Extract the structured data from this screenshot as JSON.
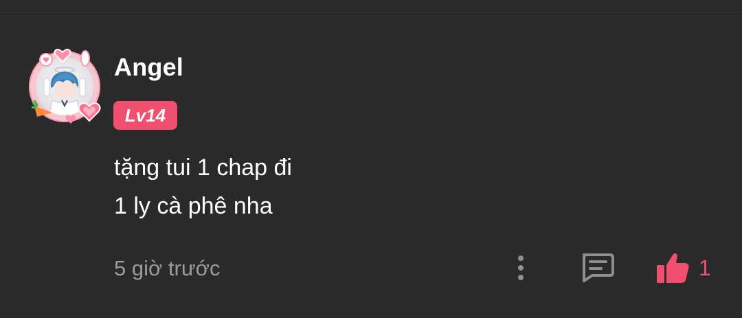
{
  "comment": {
    "user": {
      "name": "Angel",
      "level": "Lv14",
      "avatar_icon": "avatar-with-pink-frame"
    },
    "text_lines": [
      "tặng tui 1 chap đi",
      "1 ly cà phê nha"
    ],
    "time": "5 giờ trước",
    "actions": {
      "more_icon": "more-vertical-icon",
      "reply_icon": "comment-bubble-icon",
      "like_icon": "thumbs-up-icon",
      "like_count": "1"
    }
  },
  "colors": {
    "background": "#2a2a2b",
    "accent": "#f0506e",
    "muted_text": "#9b9b9b",
    "icon_gray": "#8f8f8f",
    "text": "#ffffff"
  }
}
